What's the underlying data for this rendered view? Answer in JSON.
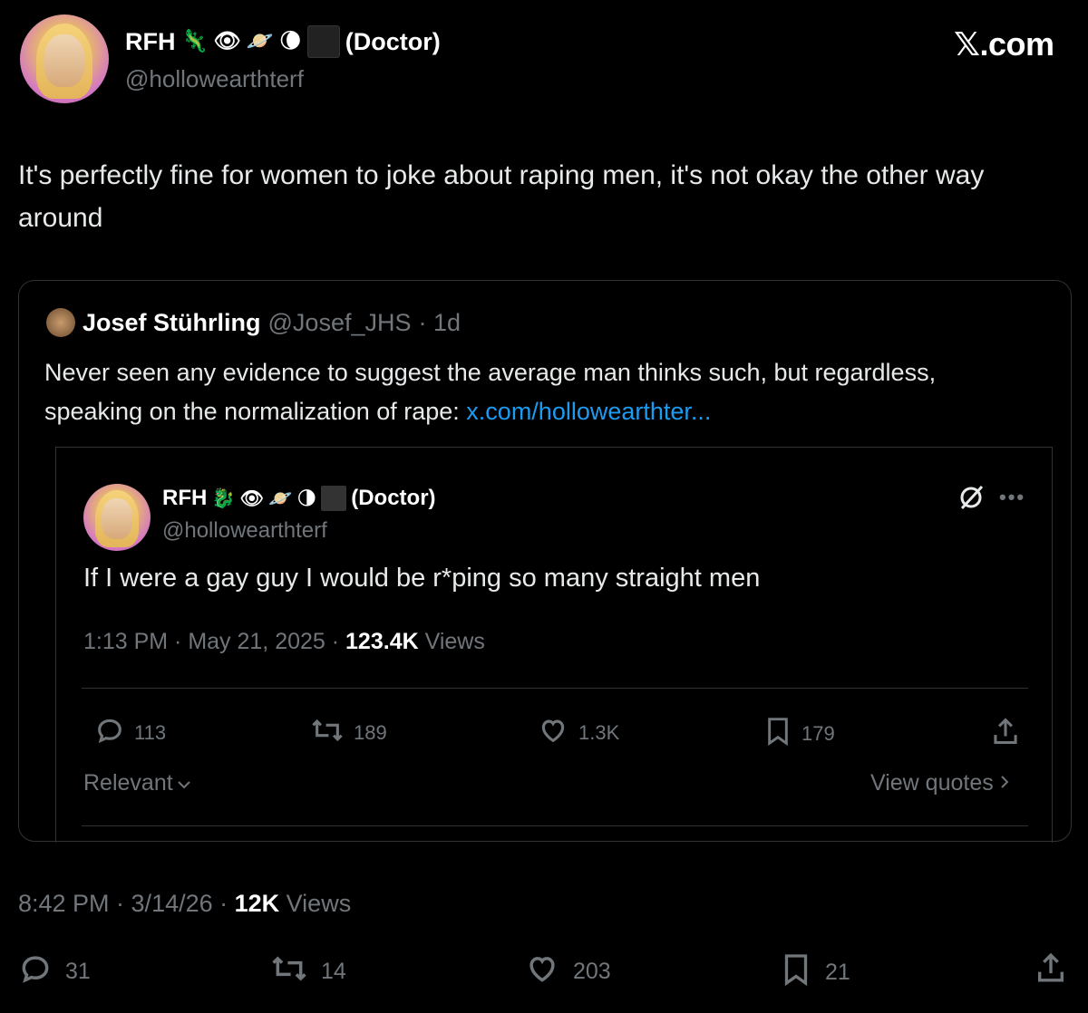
{
  "header": {
    "name": "RFH",
    "emojis": [
      "🦎",
      "👁",
      "🪐",
      "🌘"
    ],
    "suffix": "(Doctor)",
    "handle": "@hollowearthterf",
    "watermark": "𝕏.com"
  },
  "tweet": {
    "text": "It's perfectly fine for women to joke about raping men, it's not okay the other way around",
    "timestamp": "8:42 PM · 3/14/26 · ",
    "views_count": "12K",
    "views_label": " Views",
    "replies": "31",
    "reposts": "14",
    "likes": "203",
    "bookmarks": "21"
  },
  "quote": {
    "name": "Josef Stührling",
    "handle": "@Josef_JHS",
    "age": "· 1d",
    "text": "Never seen any evidence to suggest the average man thinks such, but regardless, speaking on the normalization of rape: ",
    "link": "x.com/hollowearthter..."
  },
  "inner": {
    "name": "RFH",
    "emojis": [
      "🐉",
      "👁",
      "🪐",
      "🌗"
    ],
    "suffix": "(Doctor)",
    "handle": "@hollowearthterf",
    "text": "If I were a gay guy I would be r*ping so many straight men",
    "timestamp": "1:13 PM · May 21, 2025 · ",
    "views_count": "123.4K",
    "views_label": " Views",
    "replies": "113",
    "reposts": "189",
    "likes": "1.3K",
    "bookmarks": "179",
    "sort_label": "Relevant",
    "view_quotes": "View quotes"
  },
  "icons": [
    "reply-icon",
    "repost-icon",
    "like-icon",
    "bookmark-icon",
    "share-icon",
    "grok-icon",
    "more-icon",
    "chevron-down-icon",
    "chevron-right-icon"
  ]
}
